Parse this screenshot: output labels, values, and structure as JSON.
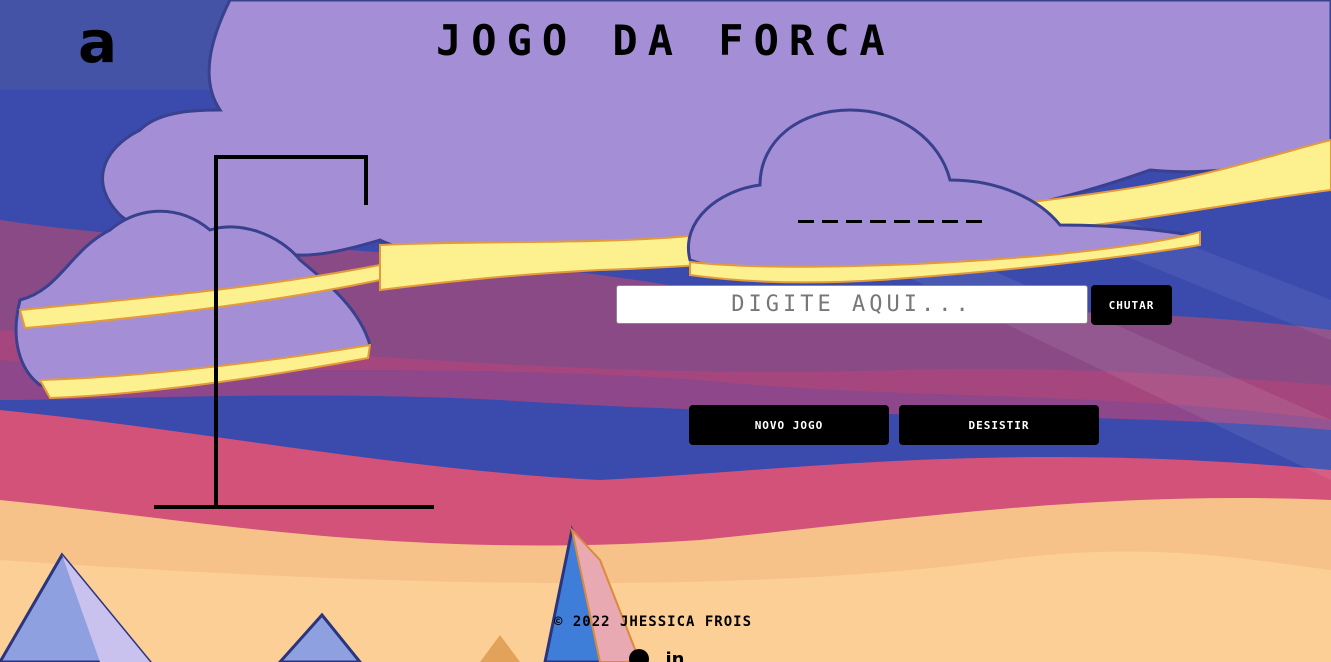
{
  "header": {
    "logo_text": "a",
    "title": "JOGO DA FORCA"
  },
  "game": {
    "word_slots": 8,
    "input_placeholder": "DIGITE AQUI...",
    "input_value": "",
    "guess_button_label": "CHUTAR",
    "new_game_button_label": "NOVO JOGO",
    "give_up_button_label": "DESISTIR"
  },
  "footer": {
    "copyright": "© 2022 JHESSICA FROIS",
    "social_icons": [
      "github-icon",
      "linkedin-icon"
    ],
    "linkedin_glyph": "in"
  },
  "colors": {
    "cloud": "#a48fd6",
    "cloud_outline": "#39418e",
    "sky_blue": "#3a4aad",
    "sand": "#f7c18a",
    "pink": "#d2527a",
    "button_bg": "#000000"
  }
}
